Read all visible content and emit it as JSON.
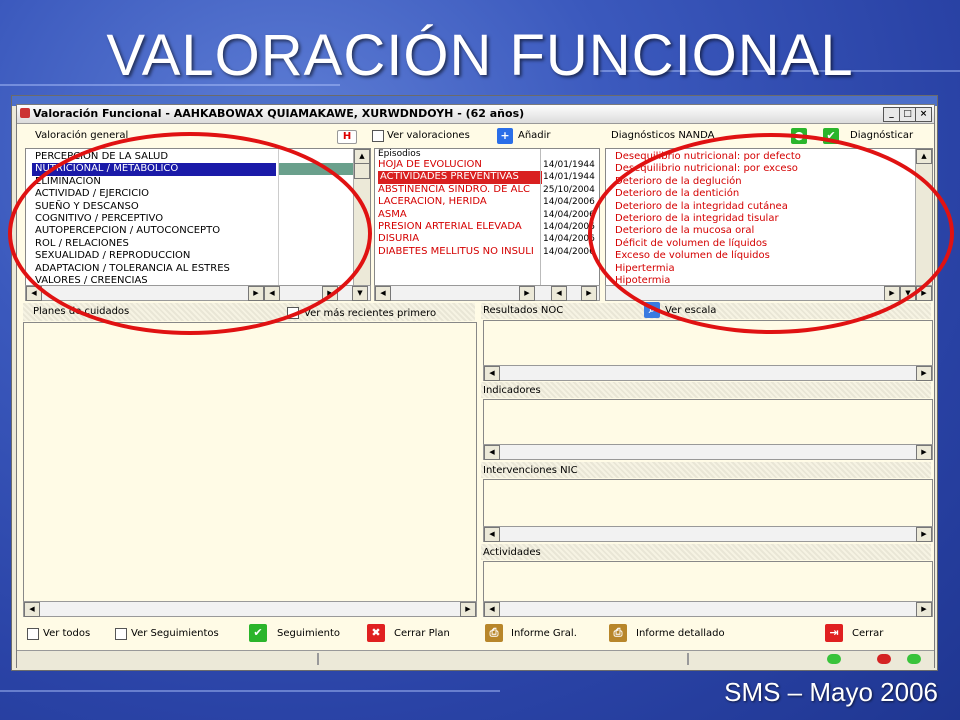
{
  "slide": {
    "title": "VALORACIÓN FUNCIONAL",
    "footer": "SMS – Mayo 2006"
  },
  "window": {
    "title": "Valoración Funcional - AAHKABOWAX QUIAMAKAWE, XURWDNDOYH - (62 años)",
    "minimize": "_",
    "maximize": "□",
    "close": "×"
  },
  "valoracion": {
    "header": "Valoración general",
    "ver_valoraciones": "Ver valoraciones",
    "anadir": "Añadir",
    "h_icon": "H",
    "items": [
      "PERCEPCION DE LA SALUD",
      "NUTRICIONAL / METABOLICO",
      "ELIMINACION",
      "ACTIVIDAD / EJERCICIO",
      "SUEÑO Y DESCANSO",
      "COGNITIVO / PERCEPTIVO",
      "AUTOPERCEPCION / AUTOCONCEPTO",
      "ROL / RELACIONES",
      "SEXUALIDAD / REPRODUCCION",
      "ADAPTACION / TOLERANCIA AL ESTRES",
      "VALORES / CREENCIAS"
    ],
    "selected_index": 1
  },
  "episodios": {
    "header": "Episodios",
    "rows": [
      {
        "name": "HOJA DE EVOLUCION",
        "date": "14/01/1944"
      },
      {
        "name": "ACTIVIDADES PREVENTIVAS",
        "date": "14/01/1944"
      },
      {
        "name": "ABSTINENCIA SINDRO. DE ALC",
        "date": "25/10/2004"
      },
      {
        "name": "LACERACION, HERIDA",
        "date": "14/04/2006"
      },
      {
        "name": "ASMA",
        "date": "14/04/2006"
      },
      {
        "name": "PRESION ARTERIAL ELEVADA",
        "date": "14/04/2006"
      },
      {
        "name": "DISURIA",
        "date": "14/04/2006"
      },
      {
        "name": "DIABETES MELLITUS NO INSULI",
        "date": "14/04/2006"
      }
    ],
    "selected_index": 1
  },
  "diagnosticos": {
    "header": "Diagnósticos NANDA",
    "diagnosticar": "Diagnósticar",
    "items": [
      "Desequilibrio nutricional: por defecto",
      "Desequilibrio nutricional: por exceso",
      "Deterioro de la deglución",
      "Deterioro de la dentición",
      "Deterioro de la integridad cutánea",
      "Deterioro de la integridad tisular",
      "Deterioro de la mucosa oral",
      "Déficit de volumen de líquidos",
      "Exceso de volumen de líquidos",
      "Hipertermia",
      "Hipotermia"
    ]
  },
  "planes": {
    "header": "Planes de cuidados",
    "ver_recientes": "Ver más recientes primero"
  },
  "noc": {
    "header": "Resultados NOC",
    "ver_escala": "Ver escala"
  },
  "indicadores": {
    "header": "Indicadores"
  },
  "nic": {
    "header": "Intervenciones NIC"
  },
  "actividades": {
    "header": "Actividades"
  },
  "toolbar": {
    "ver_todos": "Ver todos",
    "ver_seguimientos": "Ver Seguimientos",
    "seguimiento": "Seguimiento",
    "cerrar_plan": "Cerrar Plan",
    "informe_gral": "Informe Gral.",
    "informe_detallado": "Informe detallado",
    "cerrar": "Cerrar"
  },
  "colors": {
    "selection_blue": "#1a1aa8",
    "selection_red": "#d92020",
    "text_red": "#d40000",
    "oval_red": "#e01212",
    "panel_bg": "#fffbe6"
  }
}
